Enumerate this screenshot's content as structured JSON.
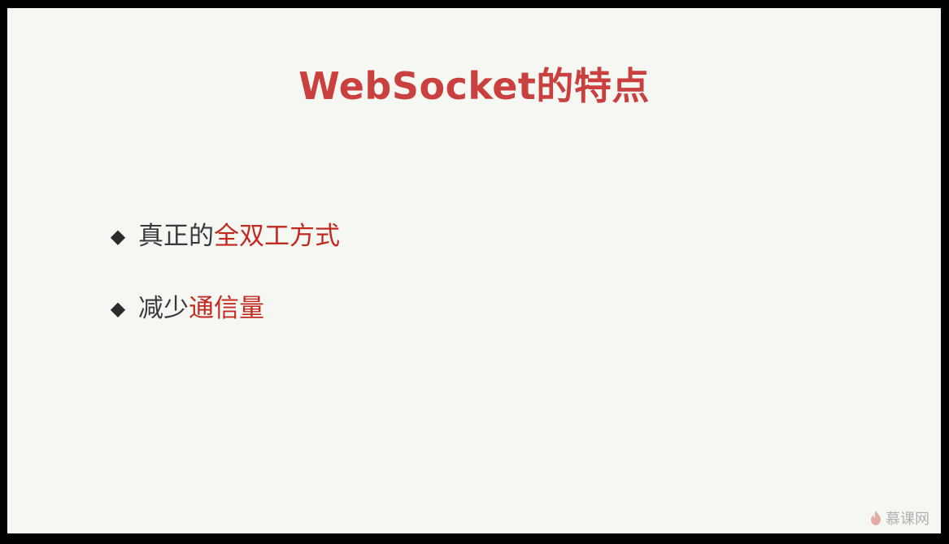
{
  "slide": {
    "title": "WebSocket的特点",
    "bullets": [
      {
        "marker": "◆",
        "plain": "真正的",
        "accent": "全双工方式"
      },
      {
        "marker": "◆",
        "plain": "减少",
        "accent": "通信量"
      }
    ]
  },
  "watermark": {
    "text": "慕课网",
    "icon": "flame-icon"
  },
  "colors": {
    "title": "#c9403f",
    "accent": "#c2291f",
    "text": "#3a3a3a",
    "background": "#f5f7f3",
    "frame": "#000000"
  }
}
